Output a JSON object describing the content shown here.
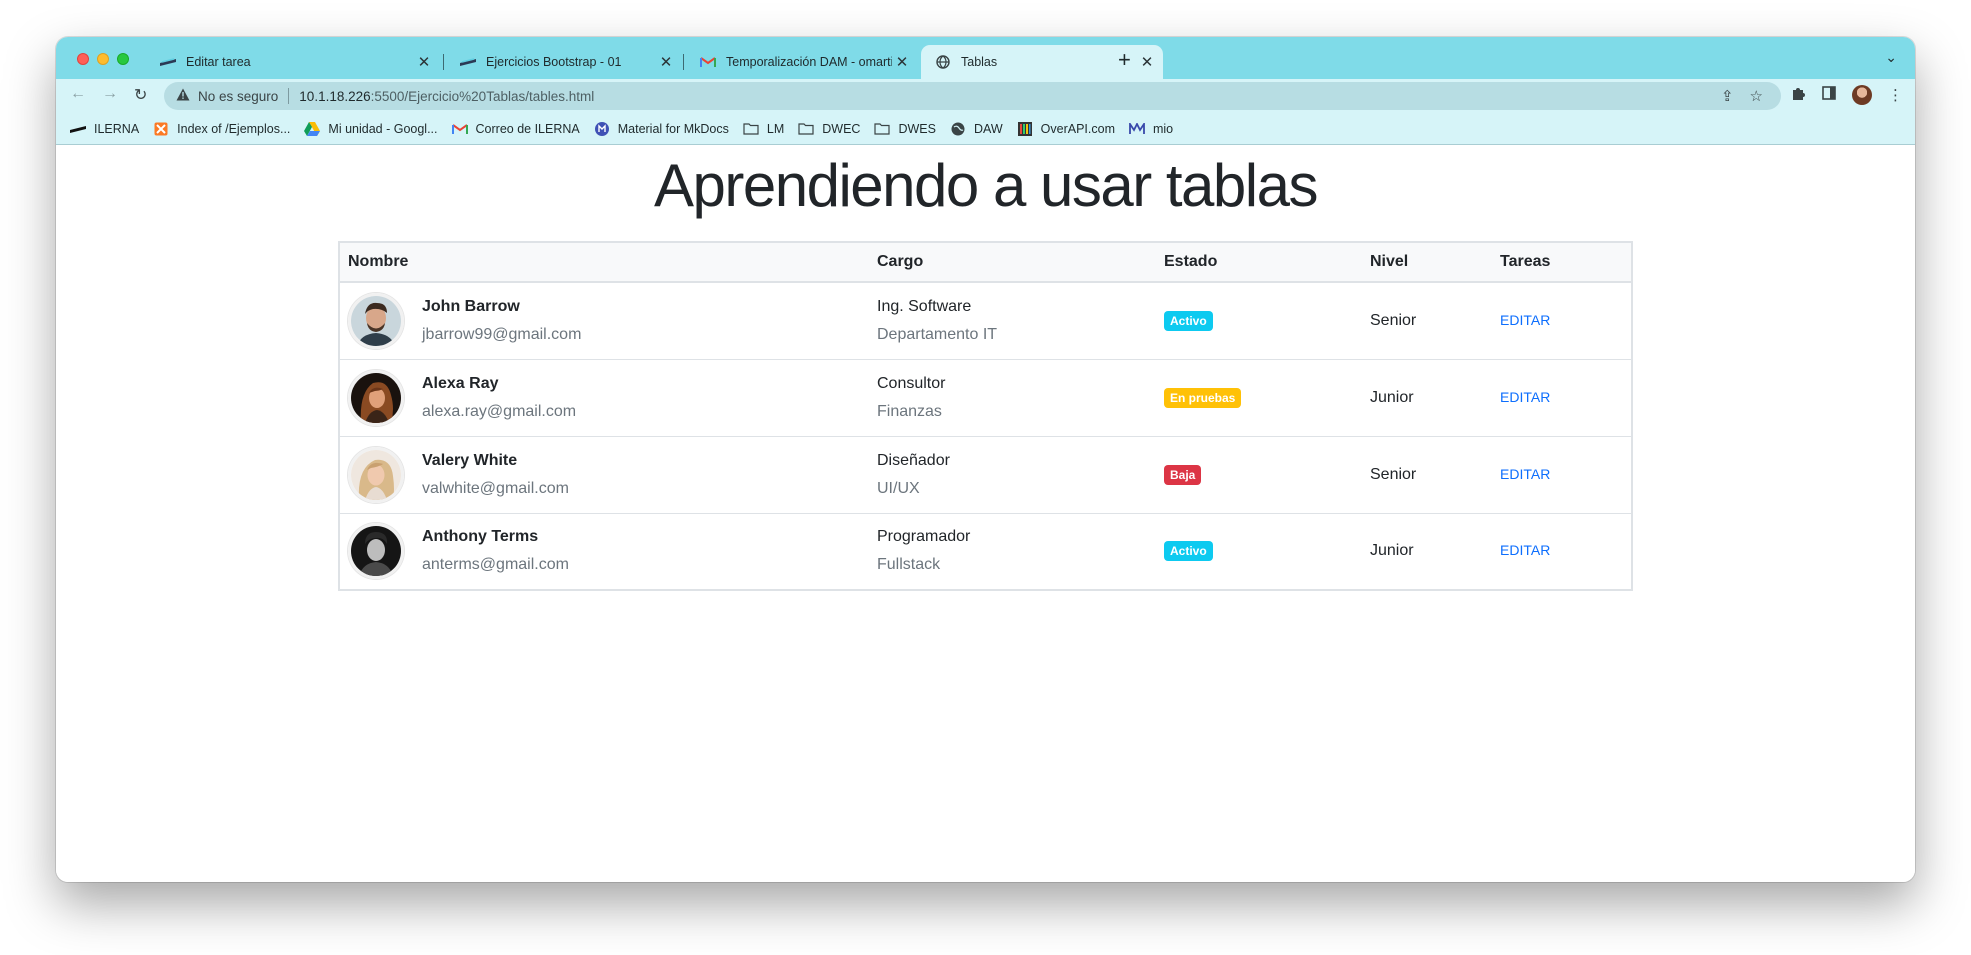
{
  "browser": {
    "tabs": [
      {
        "title": "Editar tarea",
        "favicon": "ilerna-icon",
        "active": false
      },
      {
        "title": "Ejercicios Bootstrap - 01",
        "favicon": "ilerna-icon",
        "active": false
      },
      {
        "title": "Temporalización DAM - omartin",
        "favicon": "gmail-icon",
        "active": false
      },
      {
        "title": "Tablas",
        "favicon": "globe-icon",
        "active": true
      }
    ],
    "address": {
      "security_label": "No es seguro",
      "host": "10.1.18.226",
      "rest": ":5500/Ejercicio%20Tablas/tables.html"
    },
    "bookmarks": [
      {
        "label": "ILERNA",
        "icon": "ilerna-icon"
      },
      {
        "label": "Index of /Ejemplos...",
        "icon": "xampp-icon"
      },
      {
        "label": "Mi unidad - Googl...",
        "icon": "drive-icon"
      },
      {
        "label": "Correo de ILERNA",
        "icon": "gmail-icon"
      },
      {
        "label": "Material for MkDocs",
        "icon": "mkdocs-icon"
      },
      {
        "label": "LM",
        "icon": "folder-icon"
      },
      {
        "label": "DWEC",
        "icon": "folder-icon"
      },
      {
        "label": "DWES",
        "icon": "folder-icon"
      },
      {
        "label": "DAW",
        "icon": "globe-icon"
      },
      {
        "label": "OverAPI.com",
        "icon": "overapi-icon"
      },
      {
        "label": "mio",
        "icon": "mio-icon"
      }
    ]
  },
  "page": {
    "title": "Aprendiendo a usar tablas",
    "table": {
      "headers": [
        "Nombre",
        "Cargo",
        "Estado",
        "Nivel",
        "Tareas"
      ],
      "rows": [
        {
          "name": "John Barrow",
          "email": "jbarrow99@gmail.com",
          "cargo": "Ing. Software",
          "departamento": "Departamento IT",
          "estado": "Activo",
          "nivel": "Senior",
          "accion": "EDITAR"
        },
        {
          "name": "Alexa Ray",
          "email": "alexa.ray@gmail.com",
          "cargo": "Consultor",
          "departamento": "Finanzas",
          "estado": "En pruebas",
          "nivel": "Junior",
          "accion": "EDITAR"
        },
        {
          "name": "Valery White",
          "email": "valwhite@gmail.com",
          "cargo": "Diseñador",
          "departamento": "UI/UX",
          "estado": "Baja",
          "nivel": "Senior",
          "accion": "EDITAR"
        },
        {
          "name": "Anthony Terms",
          "email": "anterms@gmail.com",
          "cargo": "Programador",
          "departamento": "Fullstack",
          "estado": "Activo",
          "nivel": "Junior",
          "accion": "EDITAR"
        }
      ]
    }
  },
  "colors": {
    "tabstrip": "#7fdbe8",
    "toolbar": "#d6f4f8",
    "badge_activo": "#0dcaf0",
    "badge_pruebas": "#ffc107",
    "badge_baja": "#dc3545",
    "link": "#0d6efd"
  }
}
